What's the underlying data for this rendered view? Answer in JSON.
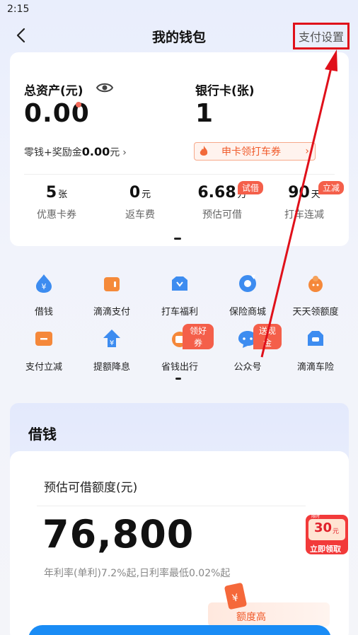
{
  "status_bar": {
    "time": "2:15"
  },
  "header": {
    "title": "我的钱包",
    "settings_label": "支付设置"
  },
  "assets": {
    "total_label": "总资产(元)",
    "total_value": "0.00",
    "bank_label": "银行卡(张)",
    "bank_value": "1",
    "change_prefix": "零钱+奖励金",
    "change_value": "0.00",
    "change_suffix": "元",
    "promo_text": "申卡领打车券"
  },
  "stats": [
    {
      "num": "5",
      "unit": "张",
      "label": "优惠卡券",
      "tag": ""
    },
    {
      "num": "0",
      "unit": "元",
      "label": "返车费",
      "tag": ""
    },
    {
      "num": "6.68",
      "unit": "万",
      "label": "预估可借",
      "tag": "试借"
    },
    {
      "num": "90",
      "unit": "天",
      "label": "打车连减",
      "tag": "立减"
    }
  ],
  "services": [
    {
      "label": "借钱",
      "icon": "drop-yen-icon",
      "tag": ""
    },
    {
      "label": "滴滴支付",
      "icon": "wallet-icon",
      "tag": ""
    },
    {
      "label": "打车福利",
      "icon": "car-gift-icon",
      "tag": ""
    },
    {
      "label": "保险商城",
      "icon": "shield-icon",
      "tag": ""
    },
    {
      "label": "天天领额度",
      "icon": "mascot-icon",
      "tag": ""
    },
    {
      "label": "支付立减",
      "icon": "ticket-icon",
      "tag": ""
    },
    {
      "label": "提额降息",
      "icon": "house-up-icon",
      "tag": ""
    },
    {
      "label": "省钱出行",
      "icon": "coupon-icon",
      "tag": "领好券"
    },
    {
      "label": "公众号",
      "icon": "chat-bubble-icon",
      "tag": "送现金"
    },
    {
      "label": "滴滴车险",
      "icon": "car-shield-icon",
      "tag": ""
    }
  ],
  "loan": {
    "title": "借钱",
    "quota_label": "预估可借额度(元)",
    "quota_value": "76,800",
    "rate_text": "年利率(单利)7.2%起,日利率最低0.02%起",
    "coupon_amount": "30",
    "coupon_unit": "元",
    "coupon_cta": "立即领取",
    "high_quota_text": "额度高"
  },
  "colors": {
    "accent_red": "#e0101a",
    "tag_red": "#f45f4a",
    "primary_blue": "#1a8cf5",
    "promo_orange": "#f05a2a"
  }
}
